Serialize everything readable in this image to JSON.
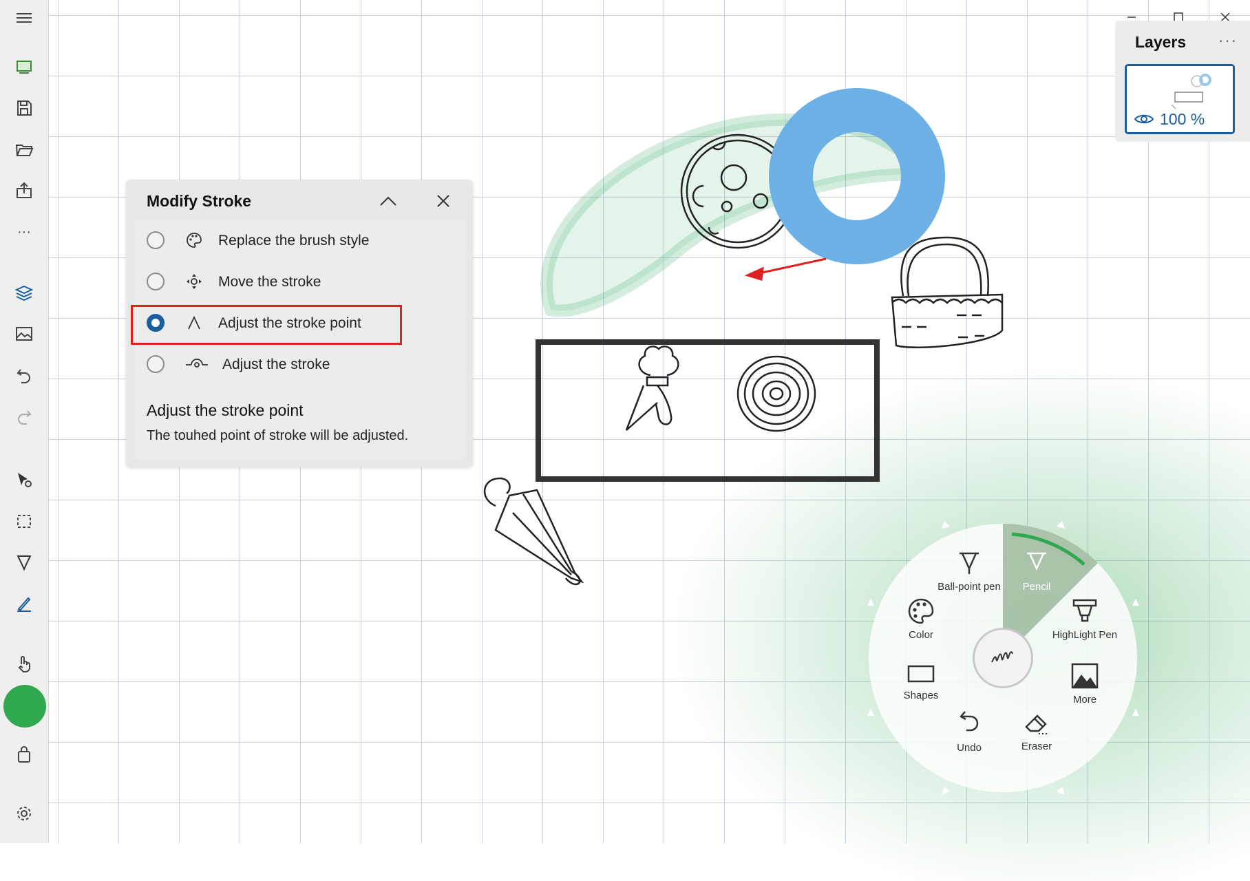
{
  "window": {
    "minimize_icon": "minimize-icon",
    "maximize_icon": "maximize-icon",
    "close_icon": "close-icon"
  },
  "toolbar": {
    "items": [
      "menu-icon",
      "slideshow-icon",
      "save-icon",
      "open-folder-icon",
      "export-icon",
      "more-icon",
      "layers-icon",
      "insert-image-icon",
      "undo-icon",
      "redo-icon",
      "select-icon",
      "selection-icon",
      "pen-icon",
      "pencil-icon",
      "touch-icon",
      "green-fab",
      "bag-icon",
      "settings-icon"
    ],
    "more_label": "···"
  },
  "layers": {
    "title": "Layers",
    "menu_label": "···",
    "opacity": "100 %"
  },
  "modify_stroke": {
    "title": "Modify Stroke",
    "options": [
      {
        "label": "Replace the brush style",
        "selected": false,
        "icon": "palette-icon"
      },
      {
        "label": "Move the stroke",
        "selected": false,
        "icon": "move-icon"
      },
      {
        "label": "Adjust the stroke point",
        "selected": true,
        "icon": "caret-icon"
      },
      {
        "label": "Adjust the stroke",
        "selected": false,
        "icon": "curve-icon"
      }
    ],
    "description_title": "Adjust the stroke point",
    "description_text": "The touhed point of stroke will be adjusted."
  },
  "radial_menu": {
    "items": [
      {
        "label": "Ball-point pen",
        "icon": "ballpoint-pen-icon"
      },
      {
        "label": "Pencil",
        "icon": "pencil-icon",
        "active": true
      },
      {
        "label": "HighLight Pen",
        "icon": "highlighter-icon"
      },
      {
        "label": "Color",
        "icon": "palette-icon"
      },
      {
        "label": "Shapes",
        "icon": "rectangle-icon"
      },
      {
        "label": "More",
        "icon": "image-icon"
      },
      {
        "label": "Undo",
        "icon": "undo-icon"
      },
      {
        "label": "Eraser",
        "icon": "eraser-icon"
      }
    ],
    "hub_icon": "scribble-icon"
  },
  "colors": {
    "accent": "#1a5e9e",
    "highlight_border": "#e02020",
    "donut": "#6cb0e6",
    "fab": "#2fa84f"
  }
}
